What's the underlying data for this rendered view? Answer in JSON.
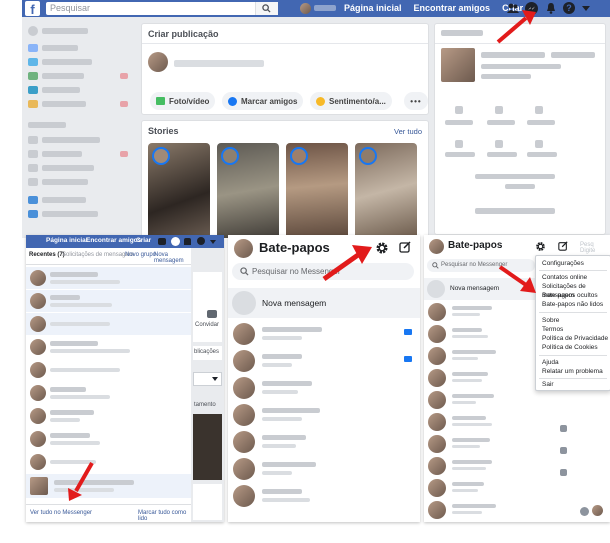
{
  "header": {
    "search_placeholder": "Pesquisar",
    "nav": [
      "Página inicial",
      "Encontrar amigos",
      "Criar"
    ]
  },
  "composer": {
    "title": "Criar publicação",
    "chips": [
      "Foto/vídeo",
      "Marcar amigos",
      "Sentimento/a..."
    ]
  },
  "stories": {
    "title": "Stories",
    "see_all": "Ver tudo"
  },
  "left_panel": {
    "nav": [
      "Página inicial",
      "Encontrar amigos",
      "Criar"
    ],
    "tabs": [
      "Recentes (7)",
      "Solicitações de mensagem"
    ],
    "actions": [
      "Novo grupo",
      "Nova mensagem"
    ],
    "footer_left": "Ver tudo no Messenger",
    "footer_right": "Marcar tudo como lido",
    "side_labels": [
      "Convidar",
      "blicações",
      "tamento"
    ]
  },
  "center_panel": {
    "title": "Bate-papos",
    "search_placeholder": "Pesquisar no Messenger",
    "new_message": "Nova mensagem"
  },
  "right_panel": {
    "title": "Bate-papos",
    "search_placeholder": "Pesquisar no Messenger",
    "new_message": "Nova mensagem",
    "side_placeholder": "Pesq  Digite",
    "menu": [
      "Configurações",
      "Contatos online",
      "Solicitações de mensagem",
      "Bate-papos ocultos",
      "Bate-papos não lidos",
      "Sobre",
      "Termos",
      "Política de Privacidade",
      "Política de Cookies",
      "Ajuda",
      "Relatar um problema",
      "Sair"
    ]
  },
  "colors": {
    "fb_blue": "#4267b2",
    "arrow_red": "#e21b1b",
    "accent": "#1877f2"
  }
}
